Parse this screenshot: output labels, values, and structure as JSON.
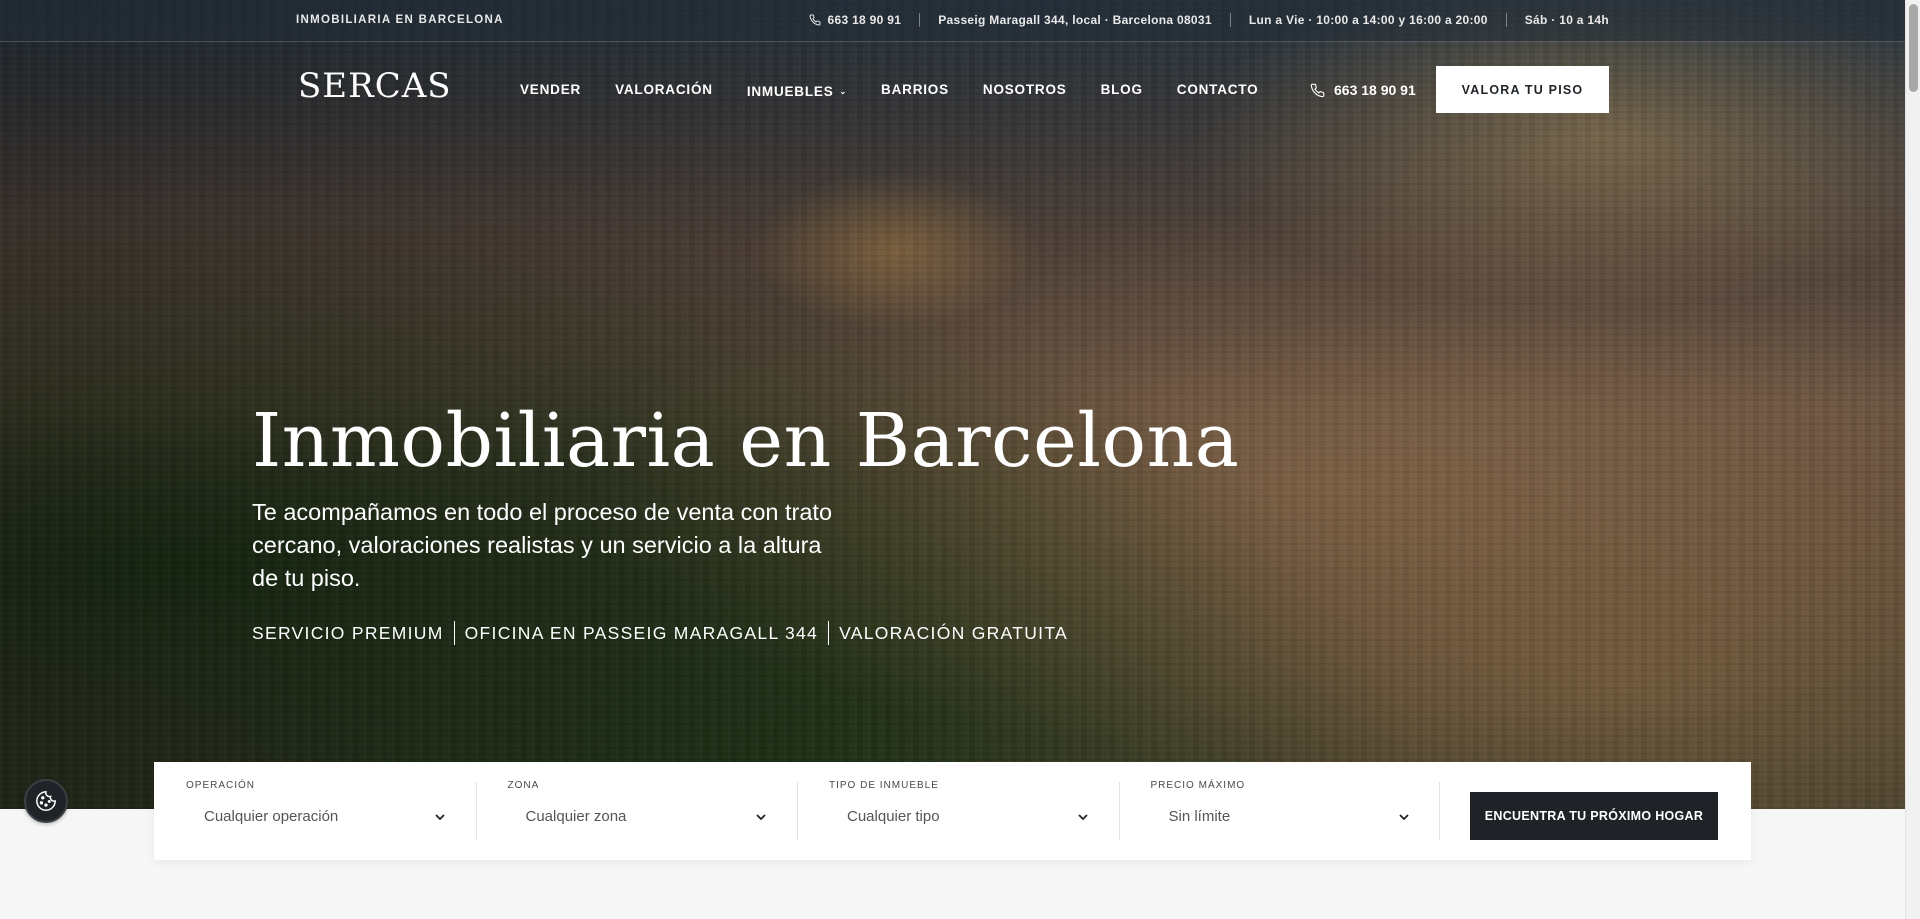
{
  "topbar": {
    "tagline": "INMOBILIARIA EN BARCELONA",
    "phone": "663 18 90 91",
    "address": "Passeig Maragall 344, local · Barcelona 08031",
    "hours_week": "Lun a Vie · 10:00 a 14:00 y 16:00 a 20:00",
    "hours_sat": "Sáb · 10 a 14h"
  },
  "header": {
    "logo": "SERCAS",
    "nav": [
      "VENDER",
      "VALORACIÓN",
      "INMUEBLES",
      "BARRIOS",
      "NOSOTROS",
      "BLOG",
      "CONTACTO"
    ],
    "phone": "663 18 90 91",
    "cta": "VALORA TU PISO"
  },
  "hero": {
    "title": "Inmobiliaria en Barcelona",
    "subtitle": "Te acompañamos en todo el proceso de venta con trato cercano, valoraciones realistas y un servicio a la altura de tu piso.",
    "tags": [
      "SERVICIO PREMIUM",
      "OFICINA EN PASSEIG MARAGALL 344",
      "VALORACIÓN GRATUITA"
    ]
  },
  "search": {
    "fields": [
      {
        "label": "OPERACIÓN",
        "value": "Cualquier operación"
      },
      {
        "label": "ZONA",
        "value": "Cualquier zona"
      },
      {
        "label": "TIPO DE INMUEBLE",
        "value": "Cualquier tipo"
      },
      {
        "label": "PRECIO MÁXIMO",
        "value": "Sin límite"
      }
    ],
    "button": "ENCUENTRA TU PRÓXIMO HOGAR"
  },
  "icons": {
    "phone": "phone-icon",
    "chevron": "chevron-down-icon",
    "cookie": "cookie-icon"
  }
}
